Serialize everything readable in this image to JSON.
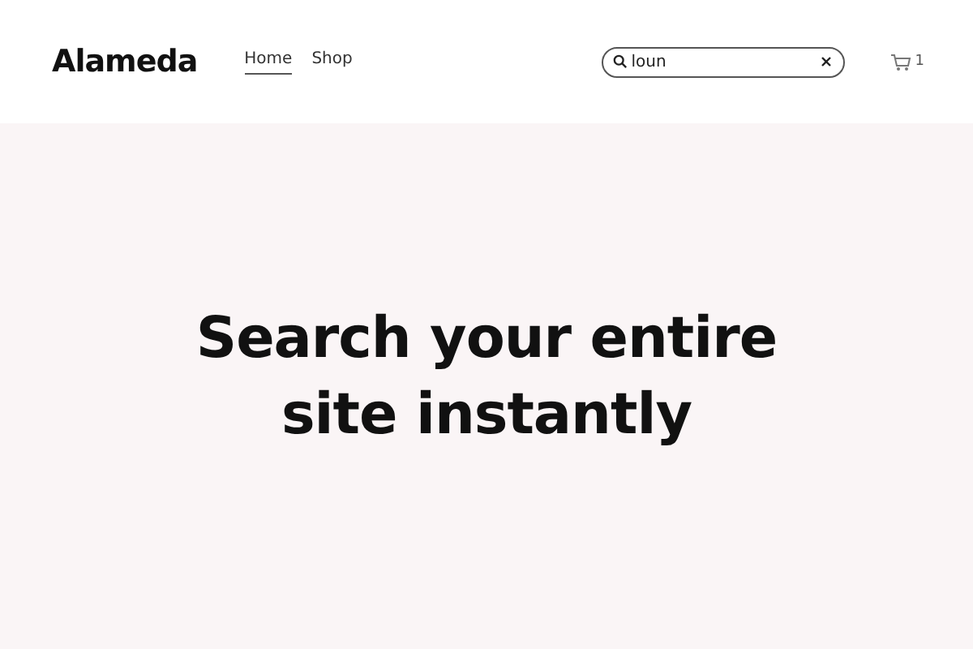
{
  "header": {
    "logo": "Alameda",
    "nav": [
      {
        "label": "Home",
        "selected": true
      },
      {
        "label": "Shop",
        "selected": false
      }
    ],
    "search": {
      "value": "loun"
    },
    "cart": {
      "count": "1"
    }
  },
  "hero": {
    "heading": "Search your entire site instantly"
  }
}
